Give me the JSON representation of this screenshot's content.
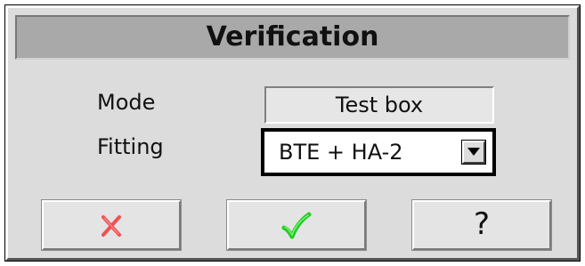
{
  "dialog": {
    "title": "Verification"
  },
  "form": {
    "mode_label": "Mode",
    "mode_value": "Test box",
    "fitting_label": "Fitting",
    "fitting_value": "BTE + HA-2"
  },
  "buttons": {
    "cancel_icon": "red-x-icon",
    "confirm_icon": "green-checkmark-icon",
    "help_label": "?"
  },
  "colors": {
    "cancel": "#f05050",
    "confirm": "#22cc22",
    "title_bar": "#a9a9a9",
    "dialog_bg": "#dcdcdc"
  }
}
